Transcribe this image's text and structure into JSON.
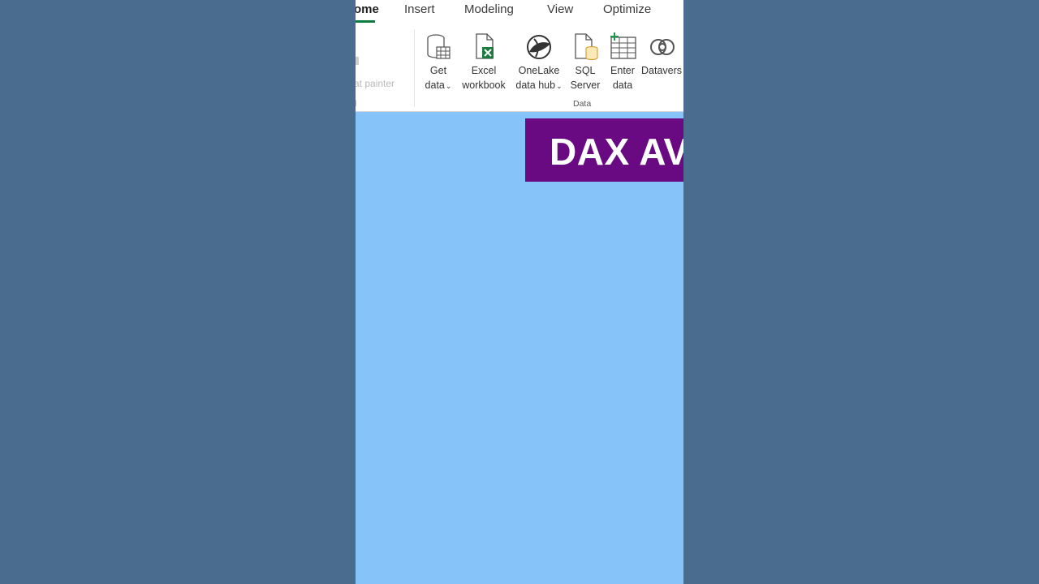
{
  "ribbon": {
    "tabs": [
      {
        "label": "ome",
        "active": true
      },
      {
        "label": "Insert"
      },
      {
        "label": "Modeling"
      },
      {
        "label": "View"
      },
      {
        "label": "Optimize"
      }
    ],
    "faded": {
      "format_painter": "at painter",
      "clipboard": "d"
    },
    "buttons": {
      "get_data": {
        "line1": "Get",
        "line2": "data",
        "chevron": "⌄",
        "icon": "database-icon"
      },
      "excel": {
        "line1": "Excel",
        "line2": "workbook",
        "icon": "excel-icon"
      },
      "onelake": {
        "line1": "OneLake",
        "line2": "data hub",
        "chevron": "⌄",
        "icon": "onelake-icon"
      },
      "sql": {
        "line1": "SQL",
        "line2": "Server",
        "icon": "sql-server-icon"
      },
      "enter_data": {
        "line1": "Enter",
        "line2": "data",
        "icon": "table-icon"
      },
      "dataverse": {
        "line1": "Datavers",
        "icon": "dataverse-icon"
      }
    },
    "group_label": "Data"
  },
  "banner": {
    "text": "DAX AV"
  },
  "colors": {
    "outer_background": "#4a6d8f",
    "canvas": "#86c3f8",
    "banner": "#6a0a82",
    "active_tab_accent": "#0f7c3f"
  }
}
